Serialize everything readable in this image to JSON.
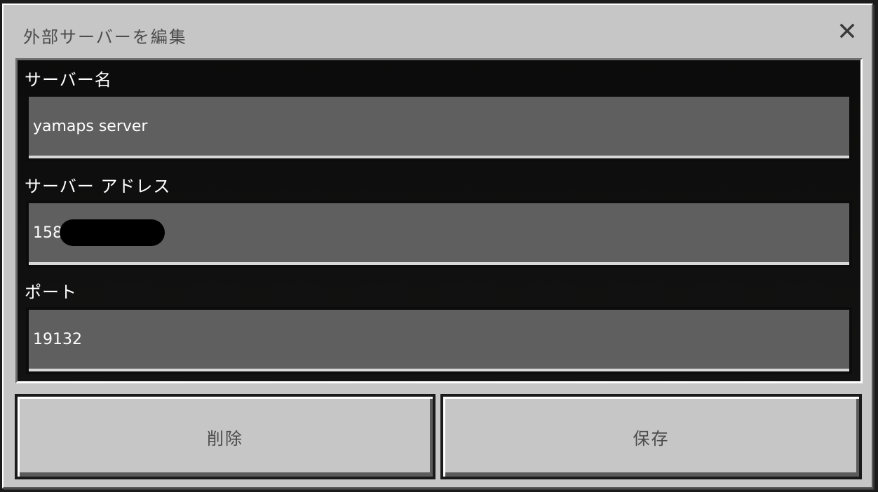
{
  "dialog": {
    "title": "外部サーバーを編集",
    "close_icon": "close-icon"
  },
  "fields": {
    "server_name": {
      "label": "サーバー名",
      "value": "yamaps server"
    },
    "server_address": {
      "label": "サーバー アドレス",
      "value": "158"
    },
    "port": {
      "label": "ポート",
      "value": "19132"
    }
  },
  "buttons": {
    "delete_label": "削除",
    "save_label": "保存"
  },
  "colors": {
    "dialog_bg": "#c6c6c6",
    "field_bg": "#5f5f5f",
    "panel_bg": "#111111",
    "text_light": "#ffffff",
    "text_dark": "#4c4c4c"
  }
}
